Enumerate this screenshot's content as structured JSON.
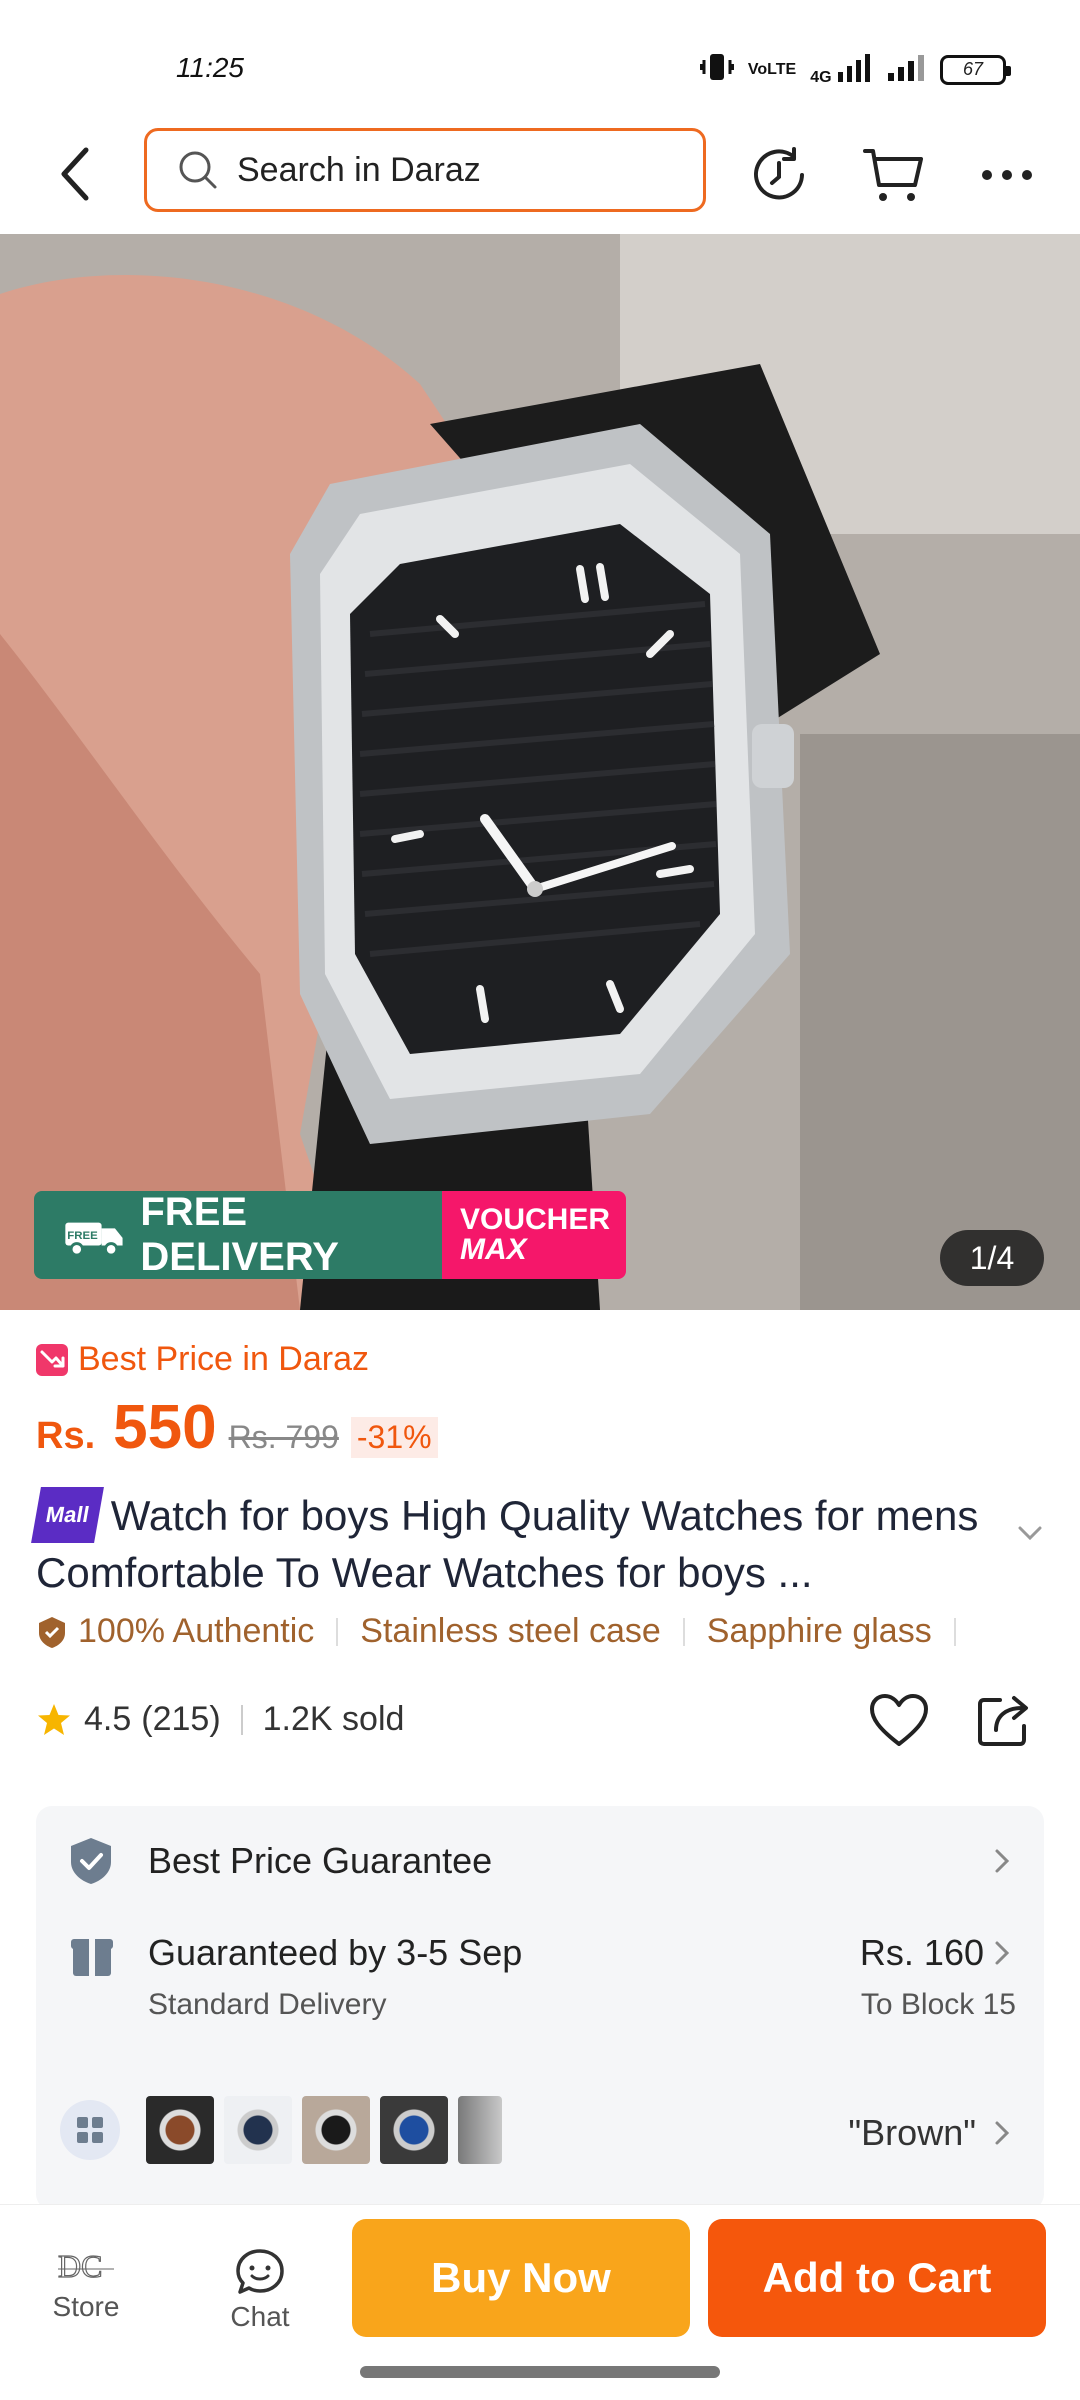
{
  "status_bar": {
    "time": "11:25",
    "icons": [
      "vibrate-icon",
      "volte-icon",
      "4g-signal-icon",
      "signal-icon"
    ],
    "volte_label": "VoLTE",
    "network_label": "4G",
    "battery": "67"
  },
  "nav": {
    "search_placeholder": "Search in Daraz"
  },
  "gallery": {
    "counter": "1/4",
    "promo_free_delivery": "FREE DELIVERY",
    "promo_free_badge": "FREE",
    "promo_voucher": "VOUCHER",
    "promo_max": "MAX"
  },
  "product": {
    "best_price_label": "Best Price in Daraz",
    "currency": "Rs.",
    "price": "550",
    "original_price": "Rs. 799",
    "discount": "-31%",
    "mall_badge": "Mall",
    "title": "Watch for boys High Quality Watches for mens Comfortable To Wear Watches for boys ...",
    "features": [
      "100% Authentic",
      "Stainless steel case",
      "Sapphire glass"
    ],
    "rating": "4.5",
    "reviews": "(215)",
    "sold": "1.2K sold"
  },
  "info_panel": {
    "guarantee_label": "Best Price Guarantee",
    "delivery_label": "Guaranteed by 3-5 Sep",
    "delivery_type": "Standard Delivery",
    "delivery_fee": "Rs. 160",
    "delivery_destination": "To Block 15",
    "selected_variant": "\"Brown\""
  },
  "bottom_bar": {
    "store_label": "Store",
    "chat_label": "Chat",
    "buy_now": "Buy Now",
    "add_to_cart": "Add to Cart"
  },
  "colors": {
    "accent_orange": "#f5570c",
    "buy_now": "#f9a51b",
    "free_delivery_green": "#2d7b66",
    "voucher_pink": "#f5176a",
    "mall_purple": "#5b2cc4"
  }
}
